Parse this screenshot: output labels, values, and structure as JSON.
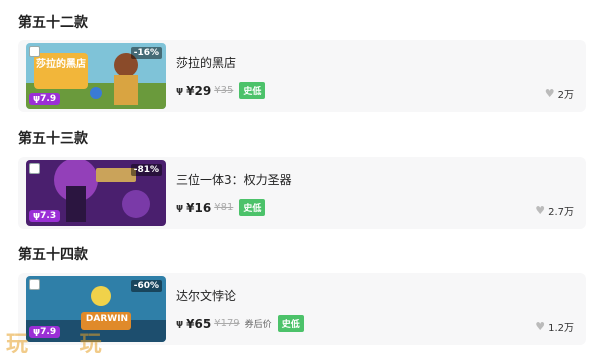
{
  "sections": [
    {
      "title": "第五十二款",
      "game": {
        "title": "莎拉的黑店",
        "thumb_text": "莎拉的黑店",
        "discount": "-16%",
        "rating": "ψ7.9",
        "price_icon": "ψ",
        "price": "¥29",
        "original": "¥35",
        "after_label": "",
        "tag": "史低",
        "likes": "2万"
      }
    },
    {
      "title": "第五十三款",
      "game": {
        "title": "三位一体3：权力圣器",
        "thumb_text": "",
        "discount": "-81%",
        "rating": "ψ7.3",
        "price_icon": "ψ",
        "price": "¥16",
        "original": "¥81",
        "after_label": "",
        "tag": "史低",
        "likes": "2.7万"
      }
    },
    {
      "title": "第五十四款",
      "game": {
        "title": "达尔文悖论",
        "thumb_text": "DARWIN",
        "discount": "-60%",
        "rating": "ψ7.9",
        "price_icon": "ψ",
        "price": "¥65",
        "original": "¥179",
        "after_label": "券后价",
        "tag": "史低",
        "likes": "1.2万"
      }
    }
  ],
  "watermark": "玩 玩"
}
